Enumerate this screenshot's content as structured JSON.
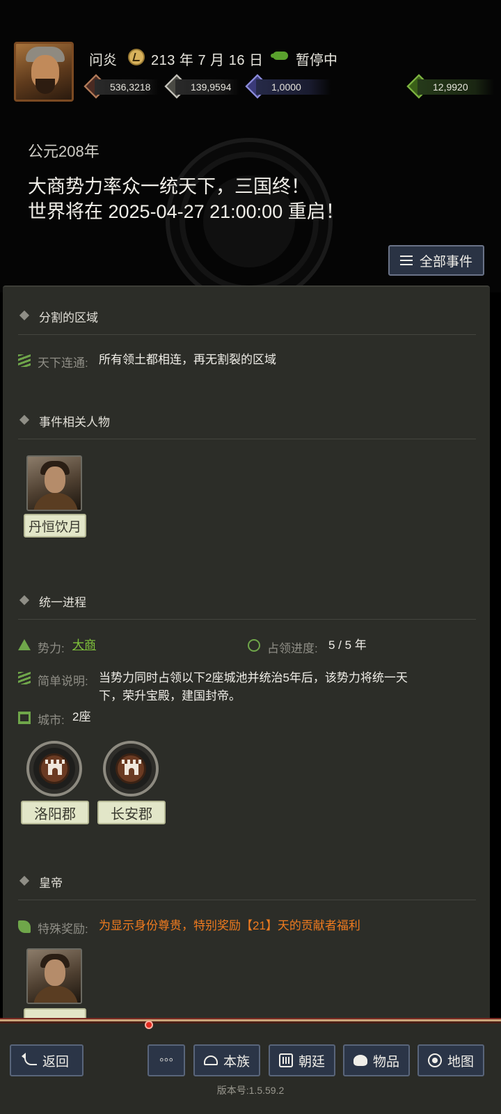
{
  "header": {
    "player_name": "问炎",
    "date": "213 年 7 月 16 日",
    "status": "暂停中",
    "resources": [
      {
        "name": "money",
        "icon": "coin-icon",
        "value": "536,3218"
      },
      {
        "name": "grain",
        "icon": "grain-icon",
        "value": "139,9594"
      },
      {
        "name": "troops",
        "icon": "soldier-icon",
        "value": "1,0000"
      },
      {
        "name": "gold",
        "icon": "gold-bag-icon",
        "value": "12,9920"
      }
    ],
    "era": "公元208年",
    "headline_1": "大商势力率众一统天下，三国终！",
    "headline_2": "世界将在 2025-04-27 21:00:00 重启！",
    "all_events_button": "全部事件"
  },
  "sections": {
    "divided": {
      "title": "分割的区域",
      "label": "天下连通:",
      "value": "所有领土都相连，再无割裂的区域"
    },
    "people": {
      "title": "事件相关人物",
      "person_name": "丹恒饮月"
    },
    "unification": {
      "title": "统一进程",
      "faction_label": "势力:",
      "faction_value": "大商",
      "progress_label": "占领进度:",
      "progress_value": "5 / 5 年",
      "desc_label": "简单说明:",
      "desc_line_1": "当势力同时占领以下2座城池并统治5年后，该势力将统一天",
      "desc_line_2": "下，荣升宝殿，建国封帝。",
      "city_label": "城市:",
      "city_count": "2座",
      "cities": [
        "洛阳郡",
        "长安郡"
      ]
    },
    "emperor": {
      "title": "皇帝",
      "reward_label": "特殊奖励:",
      "reward_value": "为显示身份尊贵，特别奖励【21】天的贡献者福利"
    }
  },
  "bottom_bar": {
    "back": "返回",
    "more": "◦◦◦",
    "clan": "本族",
    "court": "朝廷",
    "items": "物品",
    "map": "地图",
    "version": "版本号:1.5.59.2"
  }
}
